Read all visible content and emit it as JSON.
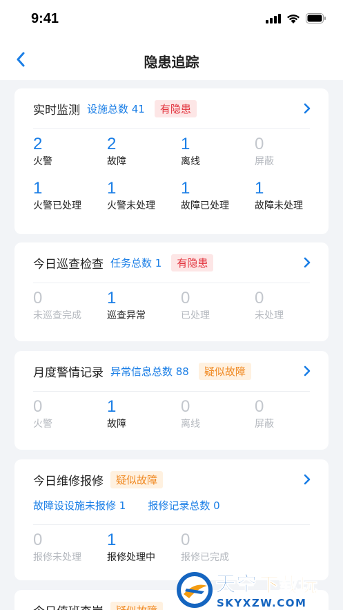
{
  "status_bar": {
    "time": "9:41"
  },
  "nav": {
    "title": "隐患追踪"
  },
  "cards": [
    {
      "title": "实时监测",
      "meta": "设施总数 41",
      "badge": "有隐患",
      "stats": [
        {
          "num": "2",
          "label": "火警"
        },
        {
          "num": "2",
          "label": "故障"
        },
        {
          "num": "1",
          "label": "离线"
        },
        {
          "num": "0",
          "label": "屏蔽"
        },
        {
          "num": "1",
          "label": "火警已处理"
        },
        {
          "num": "1",
          "label": "火警未处理"
        },
        {
          "num": "1",
          "label": "故障已处理"
        },
        {
          "num": "1",
          "label": "故障未处理"
        }
      ]
    },
    {
      "title": "今日巡查检查",
      "meta": "任务总数 1",
      "badge": "有隐患",
      "stats": [
        {
          "num": "0",
          "label": "未巡查完成"
        },
        {
          "num": "1",
          "label": "巡查异常"
        },
        {
          "num": "0",
          "label": "已处理"
        },
        {
          "num": "0",
          "label": "未处理"
        }
      ]
    },
    {
      "title": "月度警情记录",
      "meta": "异常信息总数 88",
      "badge": "疑似故障",
      "stats": [
        {
          "num": "0",
          "label": "火警"
        },
        {
          "num": "1",
          "label": "故障"
        },
        {
          "num": "0",
          "label": "离线"
        },
        {
          "num": "0",
          "label": "屏蔽"
        }
      ]
    },
    {
      "title": "今日维修报修",
      "badge": "疑似故障",
      "meta_items": [
        "故障设设施未报修 1",
        "报修记录总数 0"
      ],
      "stats": [
        {
          "num": "0",
          "label": "报修未处理"
        },
        {
          "num": "1",
          "label": "报修处理中"
        },
        {
          "num": "0",
          "label": "报修已完成"
        }
      ]
    },
    {
      "title": "今日值班查岗",
      "badge": "疑似故障"
    }
  ],
  "watermark": {
    "brand": "天空下载玩",
    "domain": "SKYXZW.COM"
  },
  "colors": {
    "accent": "#1a7ee6",
    "danger": "#e2343e",
    "warn": "#f08a24"
  }
}
